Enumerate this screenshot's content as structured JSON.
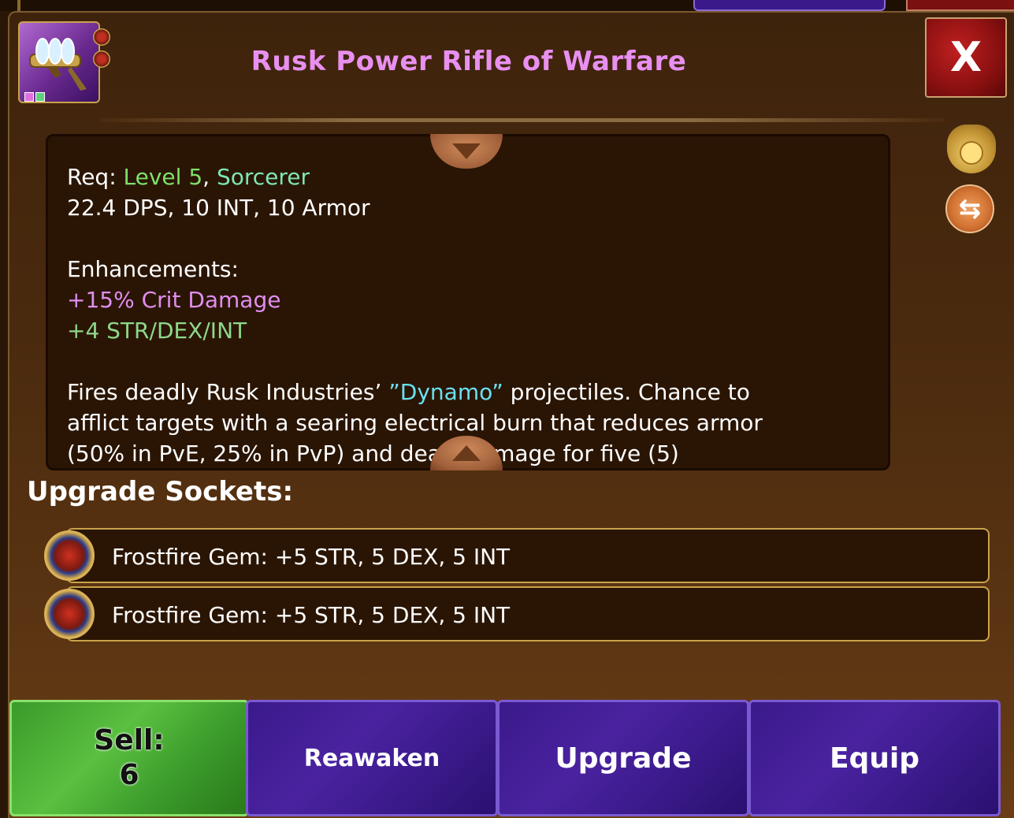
{
  "item": {
    "name": "Rusk Power Rifle of Warfare",
    "icon": "rifle-icon",
    "rarity_color": "#e890f0"
  },
  "close_label": "X",
  "description": {
    "req_label": "Req: ",
    "req_level": "Level 5",
    "req_sep": ", ",
    "req_class": "Sorcerer",
    "stats": "22.4 DPS, 10 INT, 10 Armor",
    "enhancements_label": "Enhancements:",
    "enhancement_1": "+15% Crit Damage",
    "enhancement_2": "+4 STR/DEX/INT",
    "flavor_pre": "Fires deadly Rusk Industries’ ",
    "flavor_highlight": "”Dynamo”",
    "flavor_post": " projectiles. Chance to",
    "flavor_line2": "afflict targets with a searing electrical burn that reduces armor",
    "flavor_line3": "(50% in PvE, 25% in PvP) and deals damage for five (5)"
  },
  "sockets": {
    "label": "Upgrade Sockets:",
    "items": [
      {
        "text": "Frostfire Gem: +5 STR, 5 DEX, 5 INT",
        "icon": "frostfire-gem-icon"
      },
      {
        "text": "Frostfire Gem: +5 STR, 5 DEX, 5 INT",
        "icon": "frostfire-gem-icon"
      }
    ]
  },
  "buttons": {
    "sell_label": "Sell:",
    "sell_value": "6",
    "reawaken": "Reawaken",
    "upgrade": "Upgrade",
    "equip": "Equip"
  },
  "side_icons": [
    "gold-bag-icon",
    "swap-icon"
  ],
  "colors": {
    "green": "#7ee06a",
    "pink": "#e08ef0",
    "cyan": "#6ae0f0",
    "sell_button": "#4ab030",
    "action_button": "#3a1a8a",
    "close_button": "#a01818"
  }
}
